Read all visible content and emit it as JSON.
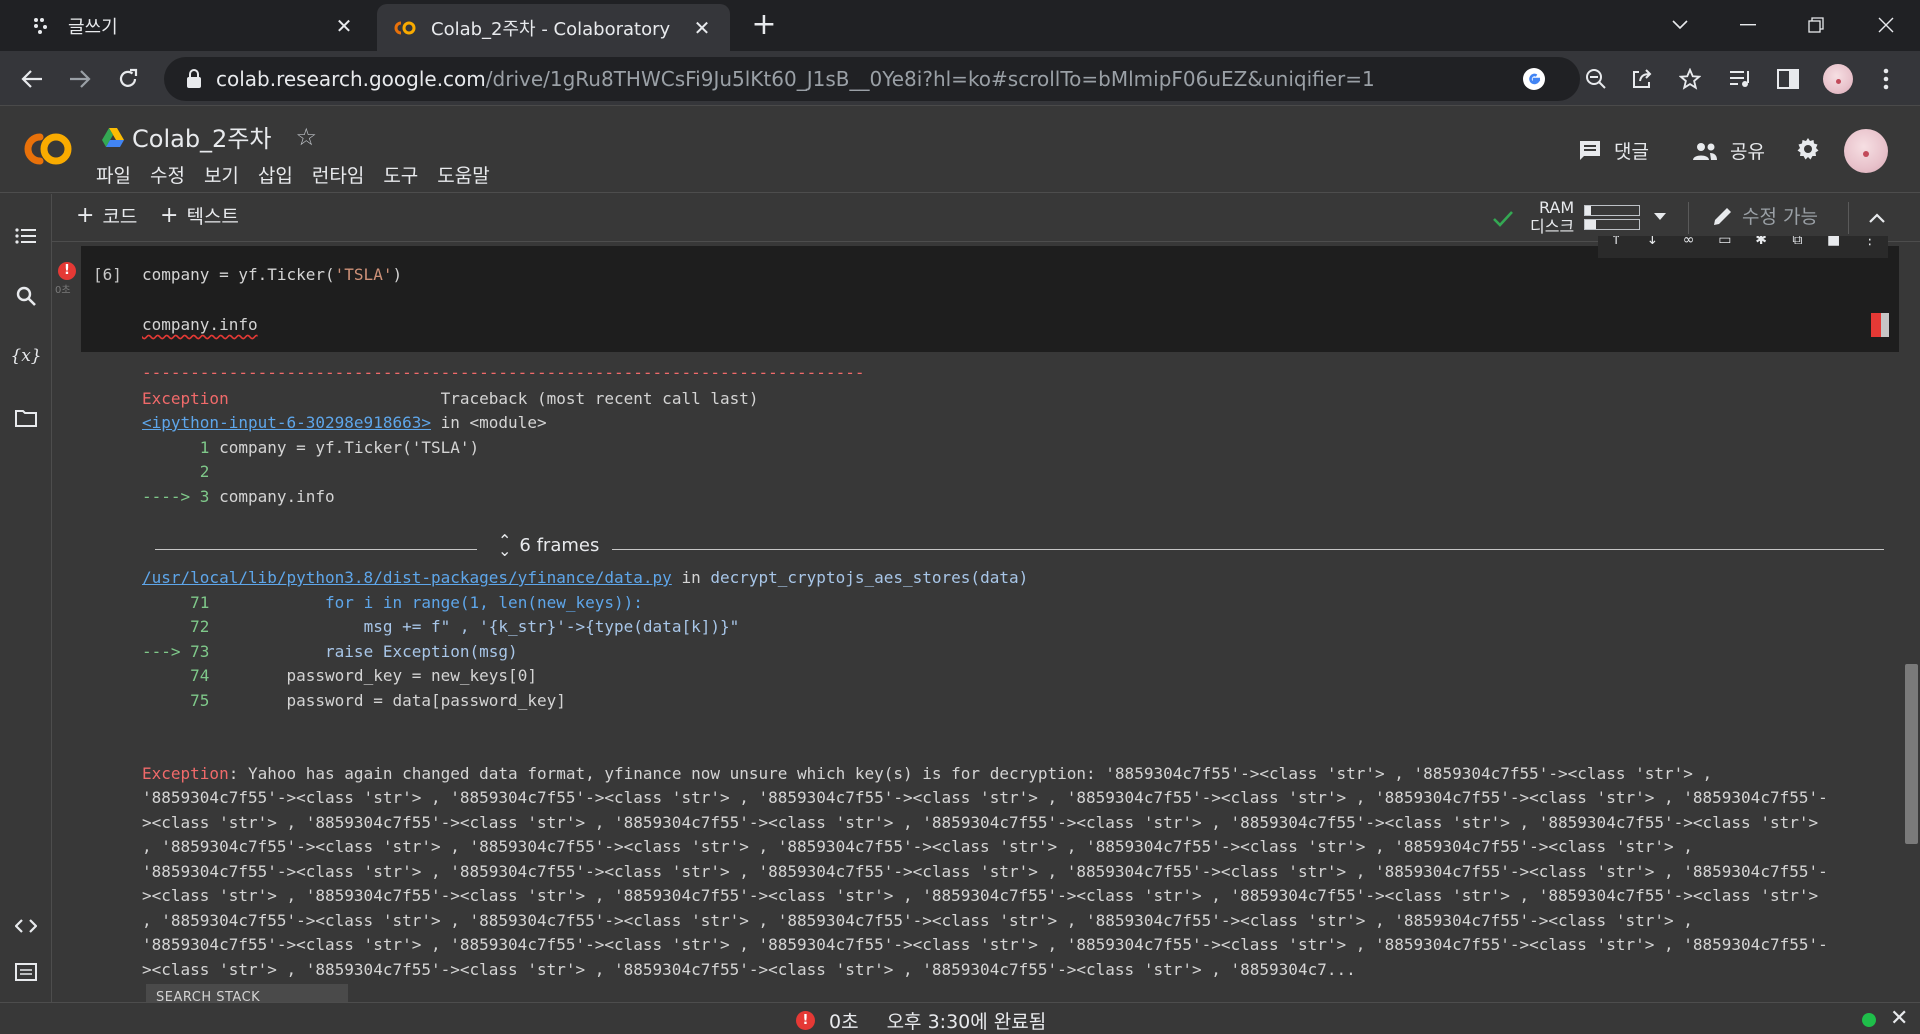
{
  "browser": {
    "tabs": [
      {
        "label": "글쓰기",
        "active": false
      },
      {
        "label": "Colab_2주차 - Colaboratory",
        "active": true
      }
    ],
    "url_host": "colab.research.google.com",
    "url_path": "/drive/1gRu8THWCsFi9Ju5lKt60_J1sB__0Ye8i?hl=ko#scrollTo=bMlmipF06uEZ&uniqifier=1"
  },
  "colab": {
    "title": "Colab_2주차",
    "menu": [
      "파일",
      "수정",
      "보기",
      "삽입",
      "런타임",
      "도구",
      "도움말"
    ],
    "comment_label": "댓글",
    "share_label": "공유",
    "add_code_label": "코드",
    "add_text_label": "텍스트",
    "ram_label": "RAM",
    "disk_label": "디스크",
    "ram_usage": 0.1,
    "disk_usage": 0.2,
    "edit_mode_label": "수정 가능"
  },
  "cell": {
    "exec_count": "[6]",
    "time": "0초",
    "line1_prefix": "company = yf.Ticker(",
    "line1_str": "'TSLA'",
    "line1_suffix": ")",
    "line2": "company.info"
  },
  "output": {
    "separator": "---------------------------------------------------------------------------",
    "exc_name": "Exception",
    "traceback_header": "Traceback (most recent call last)",
    "input_link": "<ipython-input-6-30298e918663>",
    "in_module": " in <module>",
    "tb_lines": [
      {
        "num": "      1",
        "code": " company = yf.Ticker('TSLA')"
      },
      {
        "num": "      2",
        "code": ""
      },
      {
        "num": "----> 3",
        "code": " company.info"
      }
    ],
    "frames_label": "6 frames",
    "data_link": "/usr/local/lib/python3.8/dist-packages/yfinance/data.py",
    "in_func": " in ",
    "func_name": "decrypt_cryptojs_aes_stores(data)",
    "frame_lines": [
      {
        "num": "     71",
        "code": "            for i in range(1, len(new_keys)):"
      },
      {
        "num": "     72",
        "code": "                msg += f\" , '{k_str}'->{type(data[k])}\""
      },
      {
        "num": "---> 73",
        "code": "            raise Exception(msg)"
      },
      {
        "num": "     74",
        "code": "        password_key = new_keys[0]"
      },
      {
        "num": "     75",
        "code": "        password = data[password_key]"
      }
    ],
    "exception_lines": [
      "Exception: Yahoo has again changed data format, yfinance now unsure which key(s) is for decryption: '8859304c7f55'-><class 'str'> , '8859304c7f55'-><class 'str'> ,",
      "'8859304c7f55'-><class 'str'> , '8859304c7f55'-><class 'str'> , '8859304c7f55'-><class 'str'> , '8859304c7f55'-><class 'str'> , '8859304c7f55'-><class 'str'> , '8859304c7f55'-",
      "><class 'str'> , '8859304c7f55'-><class 'str'> , '8859304c7f55'-><class 'str'> , '8859304c7f55'-><class 'str'> , '8859304c7f55'-><class 'str'> , '8859304c7f55'-><class 'str'>",
      ", '8859304c7f55'-><class 'str'> , '8859304c7f55'-><class 'str'> , '8859304c7f55'-><class 'str'> , '8859304c7f55'-><class 'str'> , '8859304c7f55'-><class 'str'> ,",
      "'8859304c7f55'-><class 'str'> , '8859304c7f55'-><class 'str'> , '8859304c7f55'-><class 'str'> , '8859304c7f55'-><class 'str'> , '8859304c7f55'-><class 'str'> , '8859304c7f55'-",
      "><class 'str'> , '8859304c7f55'-><class 'str'> , '8859304c7f55'-><class 'str'> , '8859304c7f55'-><class 'str'> , '8859304c7f55'-><class 'str'> , '8859304c7f55'-><class 'str'>",
      ", '8859304c7f55'-><class 'str'> , '8859304c7f55'-><class 'str'> , '8859304c7f55'-><class 'str'> , '8859304c7f55'-><class 'str'> , '8859304c7f55'-><class 'str'> ,",
      "'8859304c7f55'-><class 'str'> , '8859304c7f55'-><class 'str'> , '8859304c7f55'-><class 'str'> , '8859304c7f55'-><class 'str'> , '8859304c7f55'-><class 'str'> , '8859304c7f55'-",
      "><class 'str'> , '8859304c7f55'-><class 'str'> , '8859304c7f55'-><class 'str'> , '8859304c7f55'-><class 'str'> , '8859304c7..."
    ],
    "search_button": "SEARCH STACK OVERFLOW"
  },
  "status": {
    "time": "0초",
    "completed": "오후 3:30에 완료됨"
  },
  "colors": {
    "accent_orange": "#f9ab00",
    "error_red": "#e53935",
    "ok_green": "#1fbe4a"
  }
}
